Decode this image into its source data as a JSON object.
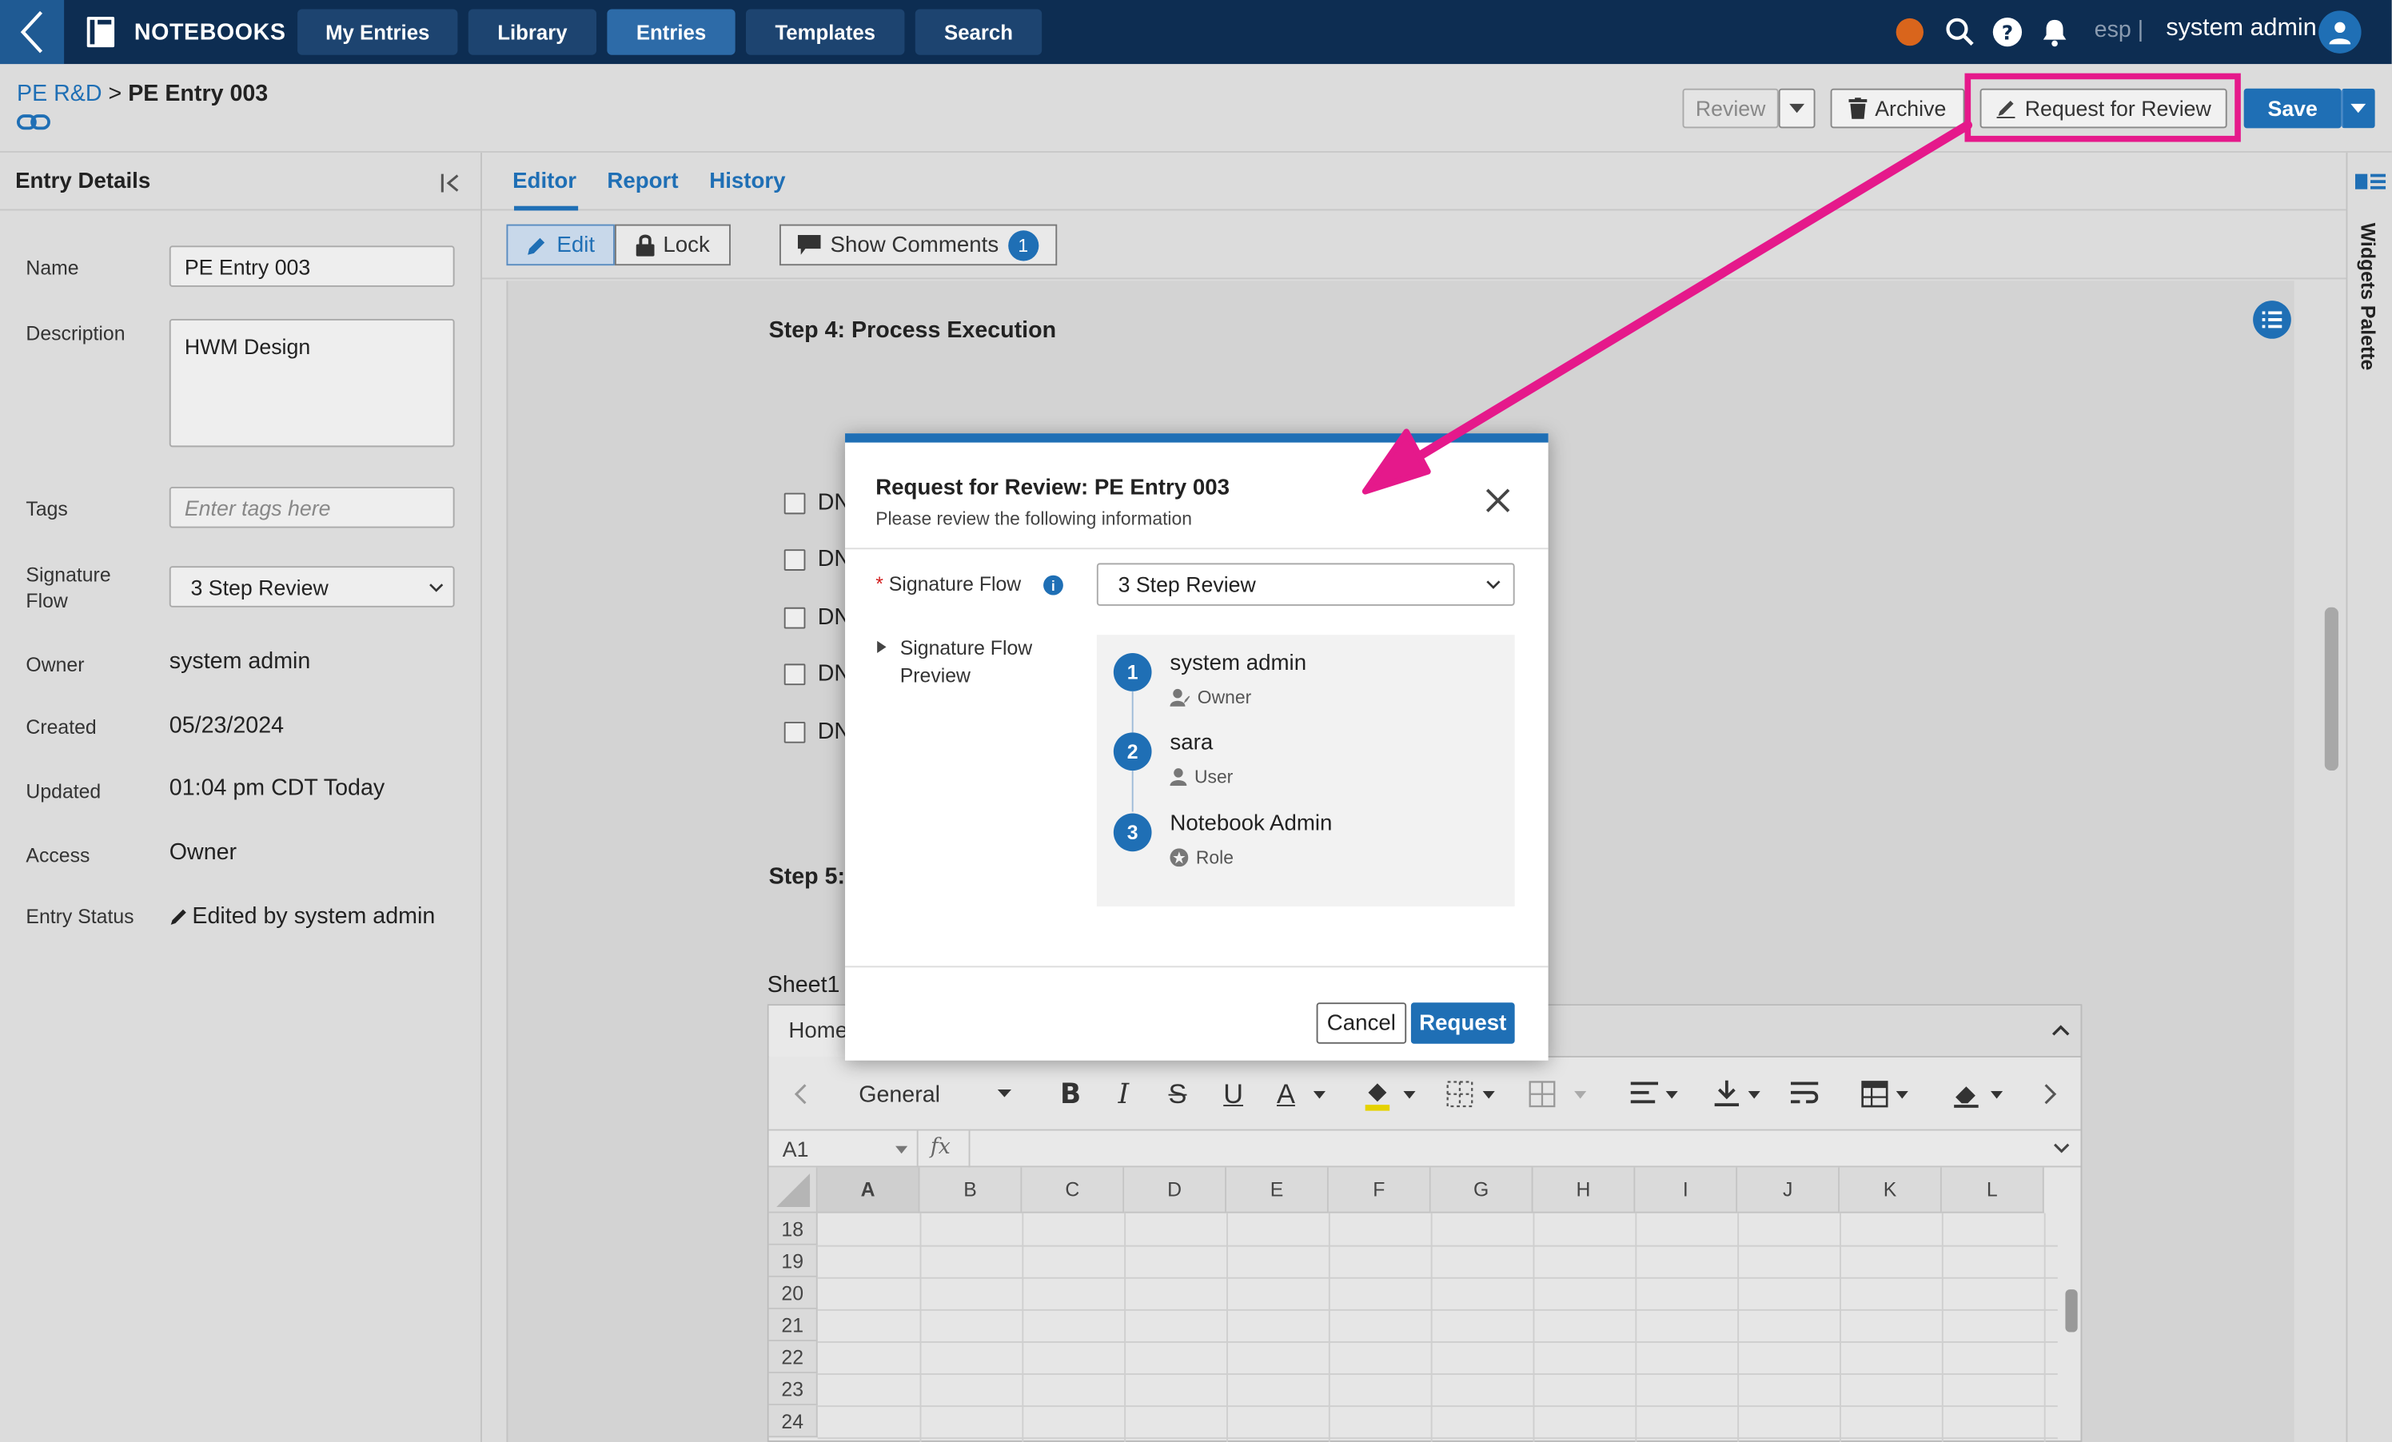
{
  "topnav": {
    "brand": "NOTEBOOKS",
    "tabs": [
      {
        "label": "My Entries",
        "active": false
      },
      {
        "label": "Library",
        "active": false
      },
      {
        "label": "Entries",
        "active": true
      },
      {
        "label": "Templates",
        "active": false
      },
      {
        "label": "Search",
        "active": false
      }
    ],
    "lang": "esp |",
    "username": "system admin",
    "status_color": "#d9651c"
  },
  "header": {
    "breadcrumb_parent": "PE R&D",
    "breadcrumb_sep": ">",
    "breadcrumb_current": "PE Entry 003",
    "review_label": "Review",
    "archive_label": "Archive",
    "request_review_label": "Request for Review",
    "save_label": "Save"
  },
  "entry_details": {
    "title": "Entry Details",
    "fields": {
      "name_label": "Name",
      "name_value": "PE Entry 003",
      "description_label": "Description",
      "description_value": "HWM Design",
      "tags_label": "Tags",
      "tags_placeholder": "Enter tags here",
      "signature_flow_label": "Signature Flow",
      "signature_flow_value": "3 Step Review",
      "owner_label": "Owner",
      "owner_value": "system admin",
      "created_label": "Created",
      "created_value": "05/23/2024",
      "updated_label": "Updated",
      "updated_value": "01:04 pm CDT Today",
      "access_label": "Access",
      "access_value": "Owner",
      "entry_status_label": "Entry Status",
      "entry_status_value": "Edited by system admin"
    }
  },
  "editor": {
    "tabs": [
      {
        "label": "Editor",
        "active": true
      },
      {
        "label": "Report",
        "active": false
      },
      {
        "label": "History",
        "active": false
      }
    ],
    "edit_label": "Edit",
    "lock_label": "Lock",
    "show_comments_label": "Show Comments",
    "comment_count": "1",
    "step4_title": "Step 4: Process Execution",
    "step5_title": "Step 5:",
    "checklist": [
      "DN",
      "DN",
      "DN",
      "DN",
      "DN"
    ],
    "widgets_palette": "Widgets Palette"
  },
  "spreadsheet": {
    "sheet_name": "Sheet1",
    "ribbon_tab": "Home",
    "number_format": "General",
    "cell_ref": "A1",
    "fx": "fx",
    "columns": [
      "A",
      "B",
      "C",
      "D",
      "E",
      "F",
      "G",
      "H",
      "I",
      "J",
      "K",
      "L"
    ],
    "rows": [
      "18",
      "19",
      "20",
      "21",
      "22",
      "23",
      "24"
    ]
  },
  "modal": {
    "title": "Request for Review: PE Entry 003",
    "subtitle": "Please review the following information",
    "required_mark": "*",
    "signature_flow_label": "Signature Flow",
    "signature_flow_value": "3 Step Review",
    "preview_label": "Signature Flow Preview",
    "steps": [
      {
        "num": "1",
        "name": "system admin",
        "role": "Owner",
        "role_icon": "owner-icon"
      },
      {
        "num": "2",
        "name": "sara",
        "role": "User",
        "role_icon": "user-icon"
      },
      {
        "num": "3",
        "name": "Notebook Admin",
        "role": "Role",
        "role_icon": "role-icon"
      }
    ],
    "cancel_label": "Cancel",
    "request_label": "Request"
  },
  "annotation": {
    "highlight_color": "#e5198b"
  }
}
